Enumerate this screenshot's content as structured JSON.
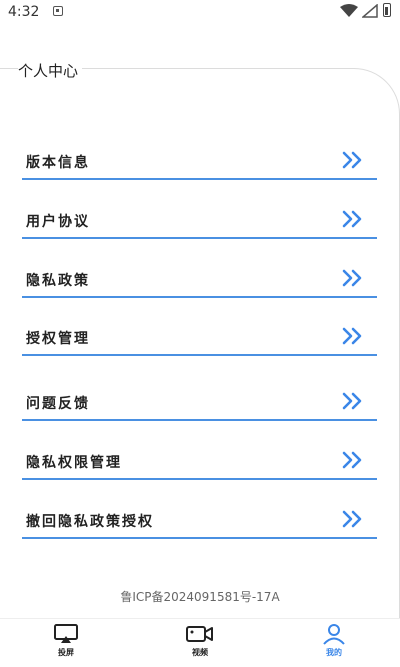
{
  "status": {
    "time": "4:32"
  },
  "page": {
    "title": "个人中心"
  },
  "menu": [
    {
      "label": "版本信息"
    },
    {
      "label": "用户协议"
    },
    {
      "label": "隐私政策"
    },
    {
      "label": "授权管理"
    },
    {
      "label": "问题反馈"
    },
    {
      "label": "隐私权限管理"
    },
    {
      "label": "撤回隐私政策授权"
    }
  ],
  "icp": "鲁ICP备2024091581号-17A",
  "tabs": [
    {
      "label": "投屏",
      "icon": "cast-icon",
      "active": false
    },
    {
      "label": "视频",
      "icon": "video-camera-icon",
      "active": false
    },
    {
      "label": "我的",
      "icon": "user-icon",
      "active": true
    }
  ],
  "colors": {
    "accent": "#3a86e8",
    "divider": "#4a90e2"
  }
}
